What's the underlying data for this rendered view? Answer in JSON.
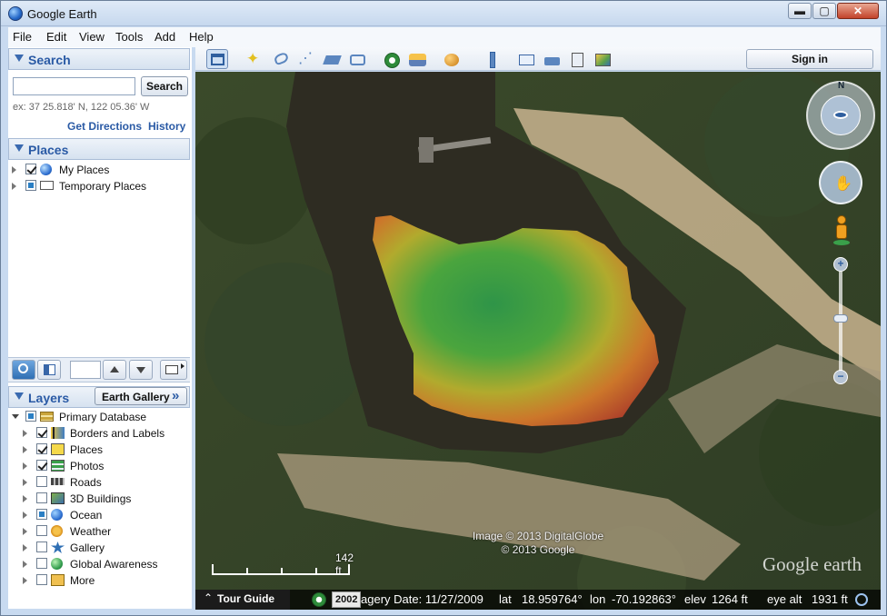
{
  "window": {
    "title": "Google Earth",
    "min_glyph": "▬",
    "max_glyph": "▢",
    "close_glyph": "✕"
  },
  "menu": [
    "File",
    "Edit",
    "View",
    "Tools",
    "Add",
    "Help"
  ],
  "search": {
    "heading": "Search",
    "input_value": "",
    "button": "Search",
    "hint": "ex: 37 25.818' N, 122 05.36' W",
    "get_directions": "Get Directions",
    "history": "History"
  },
  "places": {
    "heading": "Places",
    "items": [
      {
        "label": "My Places",
        "checked": "on",
        "icon": "globe-icon"
      },
      {
        "label": "Temporary Places",
        "checked": "partial",
        "icon": "folder-icon"
      }
    ]
  },
  "layers": {
    "heading": "Layers",
    "gallery_button": "Earth Gallery",
    "gallery_glyph": "»",
    "root": "Primary Database",
    "items": [
      {
        "label": "Borders and Labels",
        "checked": "on"
      },
      {
        "label": "Places",
        "checked": "on"
      },
      {
        "label": "Photos",
        "checked": "on"
      },
      {
        "label": "Roads",
        "checked": "off"
      },
      {
        "label": "3D Buildings",
        "checked": "off"
      },
      {
        "label": "Ocean",
        "checked": "partial"
      },
      {
        "label": "Weather",
        "checked": "off"
      },
      {
        "label": "Gallery",
        "checked": "off"
      },
      {
        "label": "Global Awareness",
        "checked": "off"
      },
      {
        "label": "More",
        "checked": "off"
      }
    ]
  },
  "toolbar": {
    "sign_in": "Sign in"
  },
  "map": {
    "credit_line1": "Image © 2013 DigitalGlobe",
    "credit_line2": "© 2013 Google",
    "watermark": "Google earth",
    "scale_label": "142 ft",
    "compass_north": "N"
  },
  "status": {
    "tour_guide": "Tour Guide",
    "tour_glyph": "⌃",
    "year": "2002",
    "imagery_date": "agery Date: 11/27/2009",
    "lat_label": "lat",
    "lat_value": "18.959764°",
    "lon_label": "lon",
    "lon_value": "-70.192863°",
    "elev_label": "elev",
    "elev_value": "1264 ft",
    "eye_alt_label": "eye alt",
    "eye_alt_value": "1931 ft"
  },
  "colors": {
    "accent": "#2a5aa5",
    "map_forest": "#3d4a2c"
  }
}
